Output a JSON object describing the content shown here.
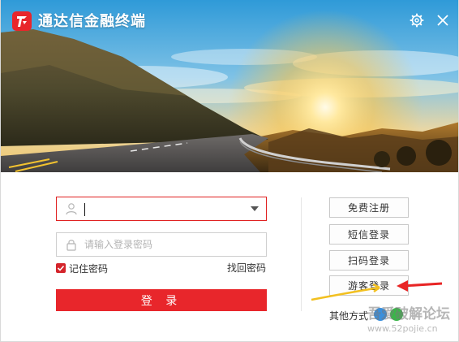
{
  "window": {
    "title": "通达信金融终端"
  },
  "login": {
    "username_value": "",
    "password_placeholder": "请输入登录密码",
    "remember_label": "记住密码",
    "remember_checked": true,
    "forgot_label": "找回密码",
    "login_label": "登 录"
  },
  "side": {
    "register_label": "免费注册",
    "sms_label": "短信登录",
    "scan_label": "扫码登录",
    "guest_label": "游客登录",
    "other_label": "其他方式"
  },
  "watermark": {
    "text": "吾爱破解论坛",
    "url": "www.52pojie.cn"
  },
  "icons": {
    "logo": "tdx-logo-icon",
    "settings": "gear-icon",
    "close": "close-icon",
    "user": "user-icon",
    "lock": "lock-icon",
    "dropdown": "chevron-down-icon",
    "check": "check-icon"
  },
  "colors": {
    "accent": "#e8262b",
    "focus_border": "#e02020"
  }
}
